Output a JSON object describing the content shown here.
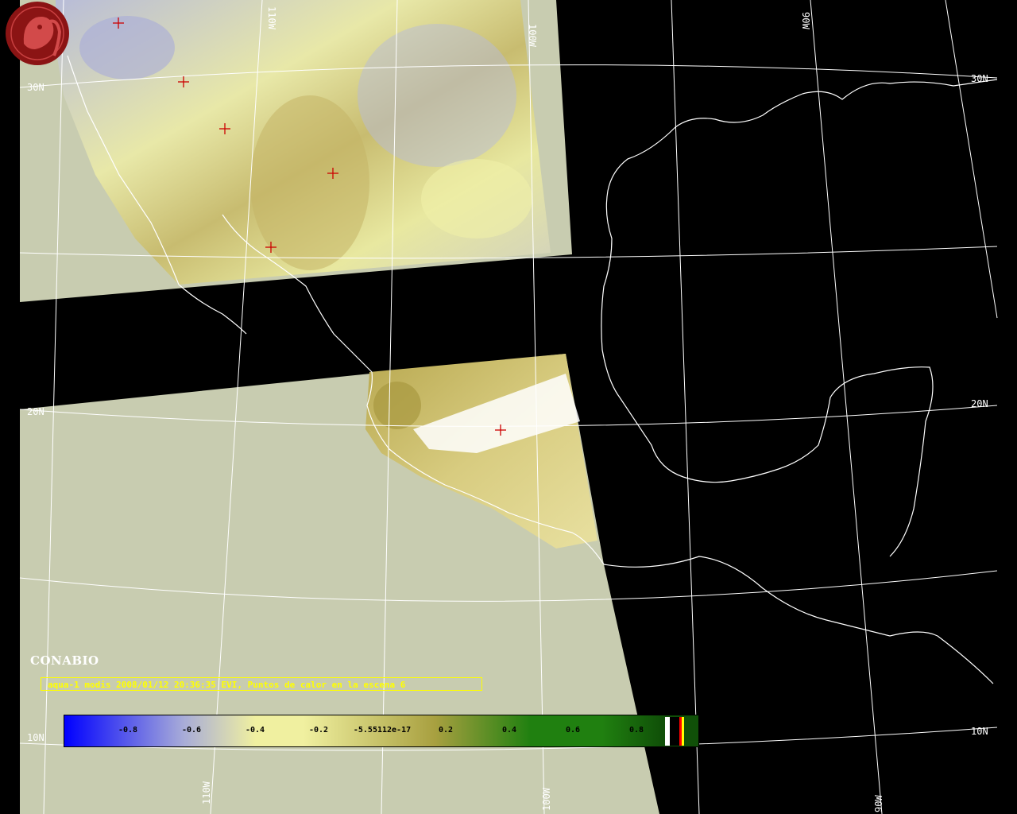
{
  "map": {
    "grid_labels": {
      "lat_30n_left": "30N",
      "lat_30n_right": "30N",
      "lat_20n_left": "20N",
      "lat_20n_right": "20N",
      "lat_10n_left": "10N",
      "lat_10n_right": "10N",
      "lon_110w_top": "110W",
      "lon_100w_top": "100W",
      "lon_90w_top": "90W",
      "lon_110w_bottom": "110W",
      "lon_100w_bottom": "100W",
      "lon_90w_bottom": "90W"
    },
    "hotspot_marker_count": 6
  },
  "caption": {
    "text": "aqua-1 modis 2008/01/12 20:36:35 EVI, Puntos de calor en la escena 6"
  },
  "colorbar": {
    "labels": [
      "-0.8",
      "-0.6",
      "-0.4",
      "-0.2",
      "-5.55112e-17",
      "0.2",
      "0.4",
      "0.6",
      "0.8"
    ],
    "colors": {
      "blue": "#0000ff",
      "lavender": "#a8acd8",
      "pale_yellow": "#f0f0a0",
      "olive": "#a8a040",
      "green": "#208010",
      "dark_green": "#105008"
    },
    "swatch_colors": [
      "#ffffff",
      "#000000",
      "#ff0000",
      "#ffff00"
    ]
  },
  "logo": {
    "text": "CONABIO",
    "color": "#8b1414"
  },
  "colors": {
    "background": "#000000",
    "no_data": "#c8ccb0",
    "grid": "#ffffff",
    "coastline": "#ffffff",
    "caption": "#ffff00",
    "hotspot": "#cc0000"
  }
}
